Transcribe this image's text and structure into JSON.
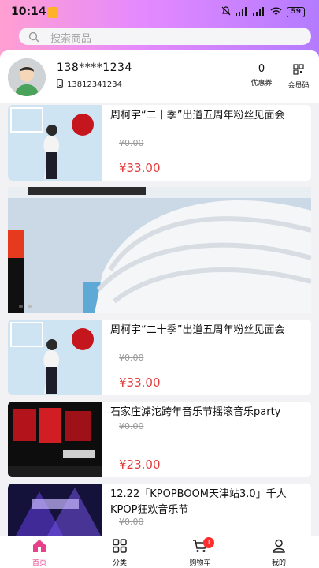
{
  "status_bar": {
    "time": "10:14",
    "battery": "59"
  },
  "search": {
    "placeholder": "搜索商品"
  },
  "profile": {
    "name": "138****1234",
    "phone": "13812341234",
    "coupon_count": "0",
    "coupon_label": "优惠券",
    "member_code_label": "会员码"
  },
  "products": [
    {
      "title": "周柯宇“二十季”出道五周年粉丝见面会",
      "old_price": "¥0.00",
      "price": "¥33.00"
    },
    {
      "title": "周柯宇“二十季”出道五周年粉丝见面会",
      "old_price": "¥0.00",
      "price": "¥33.00"
    },
    {
      "title": "石家庄滹沱跨年音乐节摇滚音乐party",
      "old_price": "¥0.00",
      "price": "¥23.00"
    },
    {
      "title": "12.22「KPOPBOOM天津站3.0」千人KPOP狂欢音乐节",
      "old_price": "¥0.00"
    }
  ],
  "tabbar": {
    "home": "首页",
    "category": "分类",
    "cart": "购物车",
    "cart_badge": "1",
    "mine": "我的"
  },
  "colors": {
    "accent": "#e8418b",
    "price": "#e23c3c",
    "header_gradient": [
      "#ff9fd2",
      "#b37bff"
    ]
  }
}
